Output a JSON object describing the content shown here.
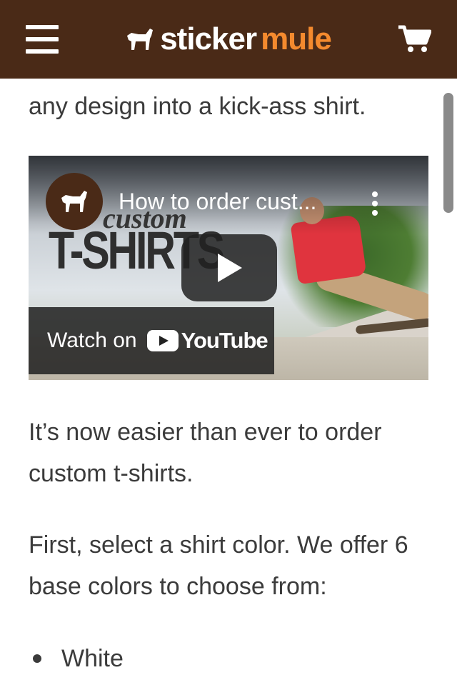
{
  "header": {
    "logo_part1": "sticker",
    "logo_part2": "mule",
    "logo_color": "#f48a2e",
    "background": "#4a2a17"
  },
  "intro": "any design into a kick-ass shirt.",
  "video": {
    "title": "How to order cust...",
    "overlay_word": "custom",
    "overlay_title": "T-SHIRTS",
    "watch_on": "Watch on",
    "youtube": "YouTube"
  },
  "paragraph1": "It’s now easier than ever to order custom t-shirts.",
  "paragraph2": "First, select a shirt color. We offer 6 base colors to choose from:",
  "colors": [
    "White"
  ]
}
